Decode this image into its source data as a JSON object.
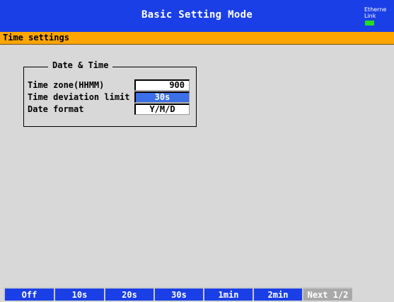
{
  "title_bar": {
    "title": "Basic Setting Mode",
    "ethernet_label": "Etherne",
    "link_label": "Link",
    "link_led_color": "#22dd22"
  },
  "section": {
    "title": "Time settings"
  },
  "group": {
    "title": "Date & Time",
    "rows": [
      {
        "label": "Time zone(HHMM)",
        "value": "900"
      },
      {
        "label": "Time deviation limit",
        "value": "30s",
        "selected": true
      },
      {
        "label": "Date format",
        "value": "Y/M/D"
      }
    ]
  },
  "softkeys": [
    "Off",
    "10s",
    "20s",
    "30s",
    "1min",
    "2min",
    "Next 1/2"
  ],
  "colors": {
    "accent_blue": "#1a3fe6",
    "section_orange": "#ffa500",
    "selection_blue": "#3a6fe8",
    "background_gray": "#d8d8d8"
  }
}
